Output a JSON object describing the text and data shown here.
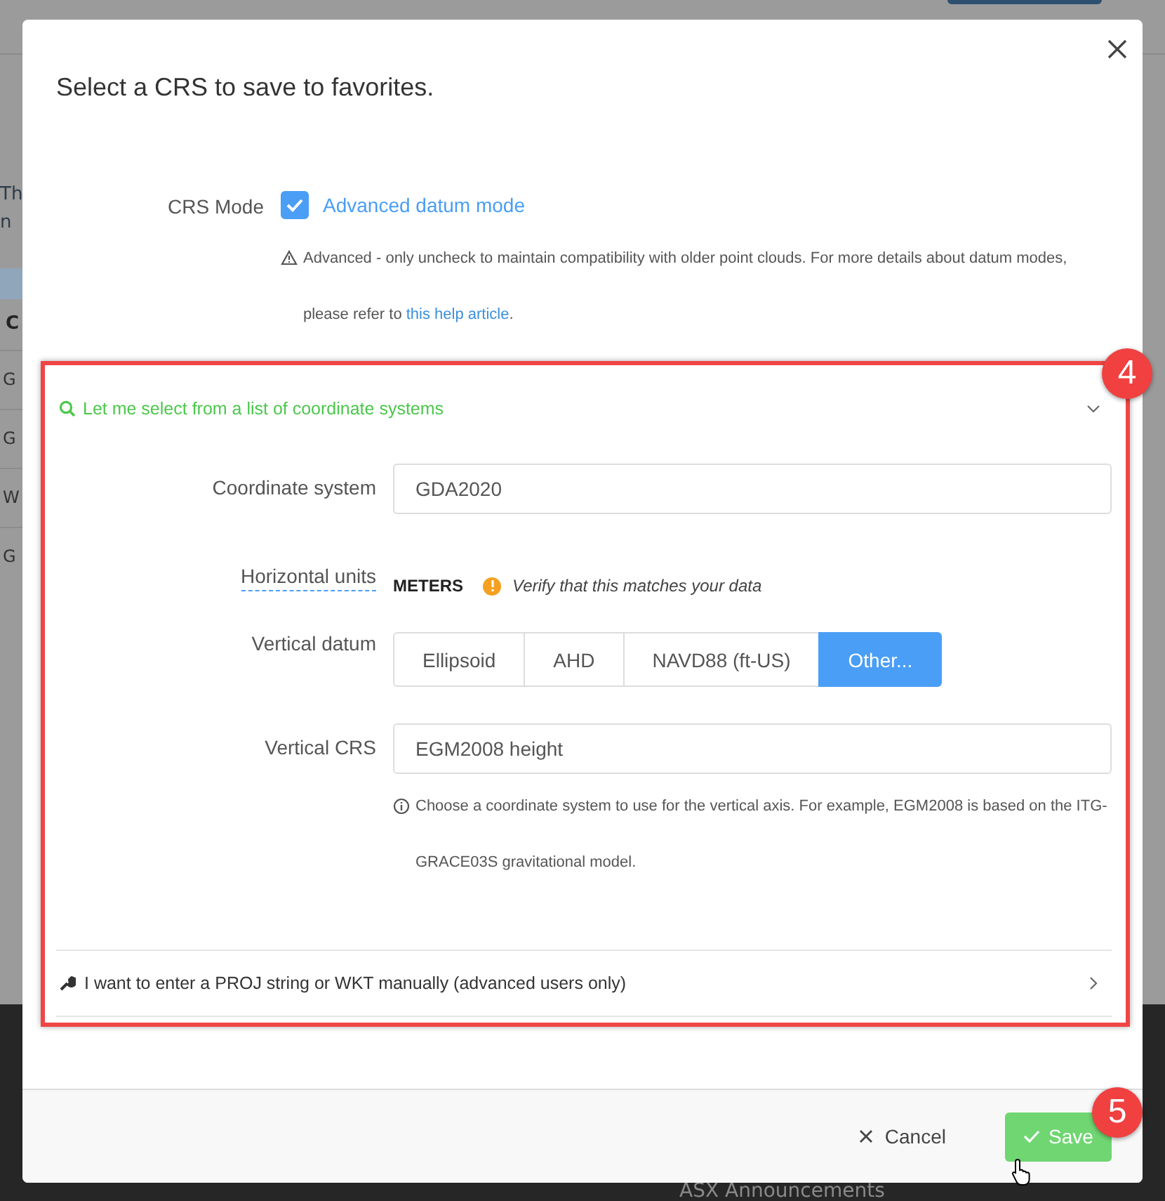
{
  "background": {
    "intro_lines": [
      "Th",
      "n"
    ],
    "table_header": "C",
    "table_rows": [
      "G",
      "G",
      "W",
      "G"
    ],
    "footer_text": "ASX Announcements"
  },
  "dialog": {
    "title": "Select a CRS to save to favorites.",
    "crs_mode": {
      "label": "CRS Mode",
      "checkbox_label": "Advanced datum mode",
      "checked": true,
      "note": "Advanced - only uncheck to maintain compatibility with older point clouds. For more details about datum modes, please refer to",
      "note_link": "this help article",
      "note_end": "."
    },
    "list_section": {
      "title": "Let me select from a list of coordinate systems",
      "expanded": true,
      "coordinate_system": {
        "label": "Coordinate system",
        "value": "GDA2020"
      },
      "horizontal_units": {
        "label": "Horizontal units",
        "value": "METERS",
        "warning": "Verify that this matches your data"
      },
      "vertical_datum": {
        "label": "Vertical datum",
        "options": [
          {
            "label": "Ellipsoid",
            "selected": false
          },
          {
            "label": "AHD",
            "selected": false
          },
          {
            "label": "NAVD88 (ft-US)",
            "selected": false
          },
          {
            "label": "Other...",
            "selected": true
          }
        ]
      },
      "vertical_crs": {
        "label": "Vertical CRS",
        "value": "EGM2008 height",
        "help": "Choose a coordinate system to use for the vertical axis. For example, EGM2008 is based on the ITG-GRACE03S gravitational model."
      }
    },
    "manual_section": {
      "title": "I want to enter a PROJ string or WKT manually (advanced users only)",
      "expanded": false
    },
    "buttons": [
      {
        "kind": "cancel",
        "label": "Cancel"
      },
      {
        "kind": "save",
        "label": "Save"
      }
    ]
  },
  "annotations": [
    "4",
    "5"
  ]
}
